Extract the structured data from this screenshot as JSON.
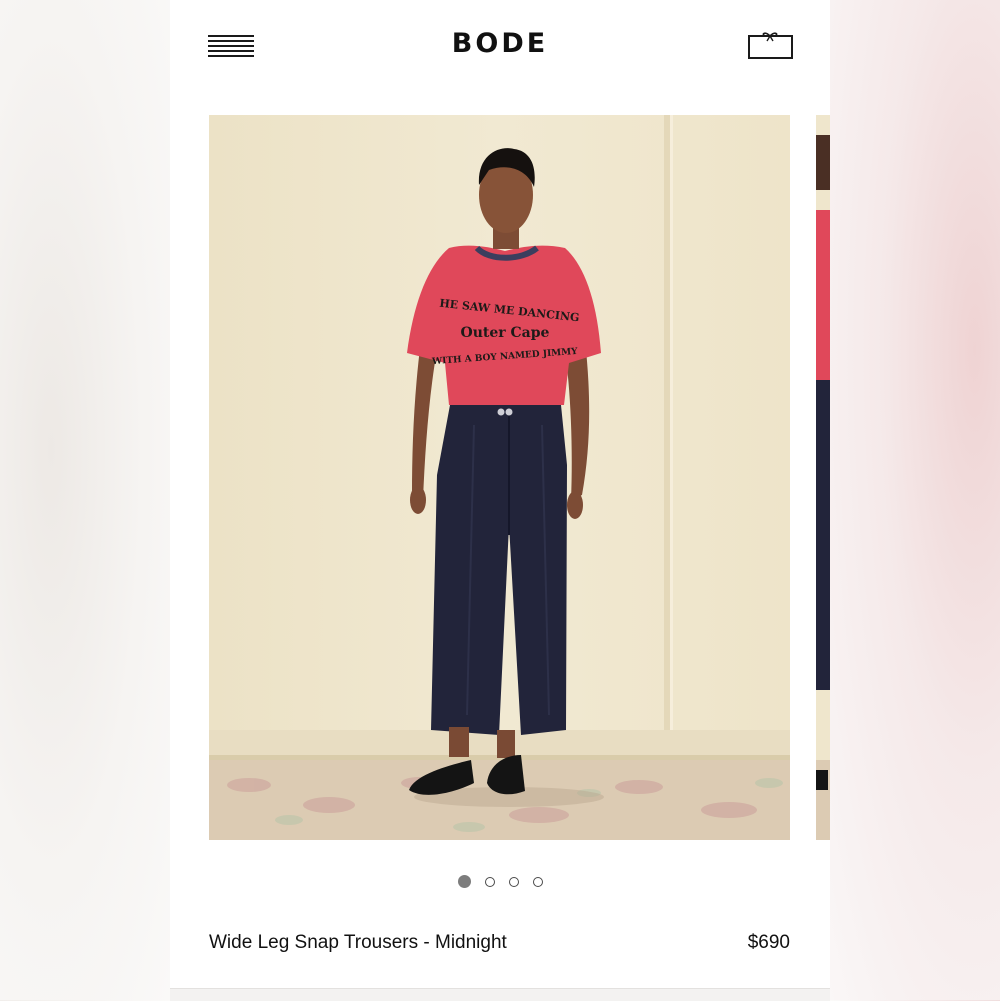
{
  "header": {
    "logo": "BODE",
    "menu_icon": "hamburger-menu-icon",
    "cart_icon": "gift-box-bag-icon"
  },
  "carousel": {
    "slide_count": 4,
    "active_index": 0,
    "tshirt_lines": [
      "He saw me Dancing",
      "Outer Cape",
      "with a boy named Jimmy"
    ]
  },
  "product": {
    "title": "Wide Leg Snap Trousers - Midnight",
    "price": "$690"
  },
  "colors": {
    "wall": "#efe6cc",
    "shirt": "#e0485a",
    "trousers": "#22243a",
    "text": "#111111"
  }
}
